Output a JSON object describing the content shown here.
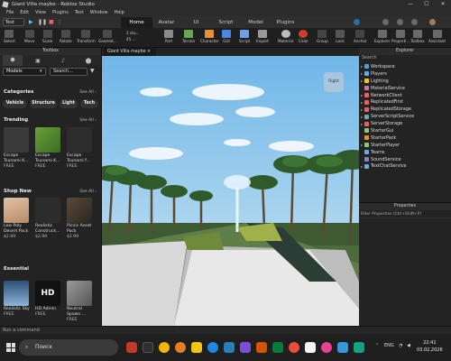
{
  "window": {
    "title": "Giant Villa maybe - Roblox Studio",
    "min": "—",
    "max": "☐",
    "close": "✕"
  },
  "menu": [
    "File",
    "Edit",
    "View",
    "Plugins",
    "Test",
    "Window",
    "Help"
  ],
  "toolbar_top": {
    "place": "Test",
    "tabs": [
      "Home",
      "Avatar",
      "UI",
      "Script",
      "Model",
      "Plugins"
    ],
    "active_tab": "Home"
  },
  "ribbon": [
    "Select",
    "Move",
    "Scale",
    "Rotate",
    "Transform",
    "Geomet...",
    "Part",
    "Terrain",
    "Character",
    "GUI",
    "Script",
    "Import",
    "Material",
    "Color",
    "Group",
    "Lock",
    "Anchor",
    "Explorer",
    "Properti...",
    "Toolbox",
    "Assistant"
  ],
  "ribbon_values": {
    "move_step": "2 stu...",
    "rotate_step": "45 ...",
    "icons": [
      "play-icon",
      "pause-icon",
      "stop-icon"
    ]
  },
  "toolbox": {
    "title": "Toolbox",
    "category": "Models",
    "search_placeholder": "Search...",
    "categories_title": "Categories",
    "see_all": "See All ›",
    "chips": [
      "Vehicle",
      "Structure",
      "Light",
      "Tech"
    ],
    "trending_title": "Trending",
    "trending": [
      {
        "name": "Escape Tsunami K...",
        "price": "FREE",
        "color": "#3a3a3a"
      },
      {
        "name": "Escape Tsunami K...",
        "price": "FREE",
        "color": "#4e8a2e"
      },
      {
        "name": "Escape Tsunami f...",
        "price": "FREE",
        "color": "#2d2d2d"
      }
    ],
    "shop_title": "Shop New",
    "shop": [
      {
        "name": "Low Poly Desert Pack",
        "price": "$2.99",
        "color": "#cfa98a"
      },
      {
        "name": "Realistic Construck...",
        "price": "$2.99",
        "color": "#2c2c2c"
      },
      {
        "name": "Picnic Asset Pack",
        "price": "$2.99",
        "color": "#3a3530"
      }
    ],
    "essential_title": "Essential",
    "essential": [
      {
        "name": "Realistic Sky",
        "price": "FREE",
        "color": "#5a7fa8"
      },
      {
        "name": "HD Admin",
        "price": "FREE",
        "color": "#111111",
        "logo": "HD"
      },
      {
        "name": "Neutral Spawn ...",
        "price": "FREE",
        "color": "#777777"
      }
    ]
  },
  "viewport": {
    "tab": "Giant Villa maybe ✕",
    "badge": "Right"
  },
  "explorer": {
    "title": "Explorer",
    "search": "Search",
    "items": [
      {
        "label": "Workspace",
        "color": "#5b9bd5"
      },
      {
        "label": "Players",
        "color": "#6fa8dc"
      },
      {
        "label": "Lighting",
        "color": "#f1c232"
      },
      {
        "label": "MaterialService",
        "color": "#c27ba0"
      },
      {
        "label": "NetworkClient",
        "color": "#e06666"
      },
      {
        "label": "ReplicatedFirst",
        "color": "#e06666"
      },
      {
        "label": "ReplicatedStorage",
        "color": "#e06666"
      },
      {
        "label": "ServerScriptService",
        "color": "#76a5af"
      },
      {
        "label": "ServerStorage",
        "color": "#e06666"
      },
      {
        "label": "StarterGui",
        "color": "#93c47d"
      },
      {
        "label": "StarterPack",
        "color": "#e69138"
      },
      {
        "label": "StarterPlayer",
        "color": "#93c47d"
      },
      {
        "label": "Teams",
        "color": "#6fa8dc"
      },
      {
        "label": "SoundService",
        "color": "#8e7cc3"
      },
      {
        "label": "TextChatService",
        "color": "#6fa8dc"
      }
    ]
  },
  "properties": {
    "title": "Properties",
    "filter": "Filter Properties (Ctrl+Shift+P)"
  },
  "command_bar": {
    "placeholder": "Run a command"
  },
  "taskbar": {
    "search": "Поиск",
    "lang": "ENG",
    "time": "22:41",
    "date": "03.02.2026"
  }
}
